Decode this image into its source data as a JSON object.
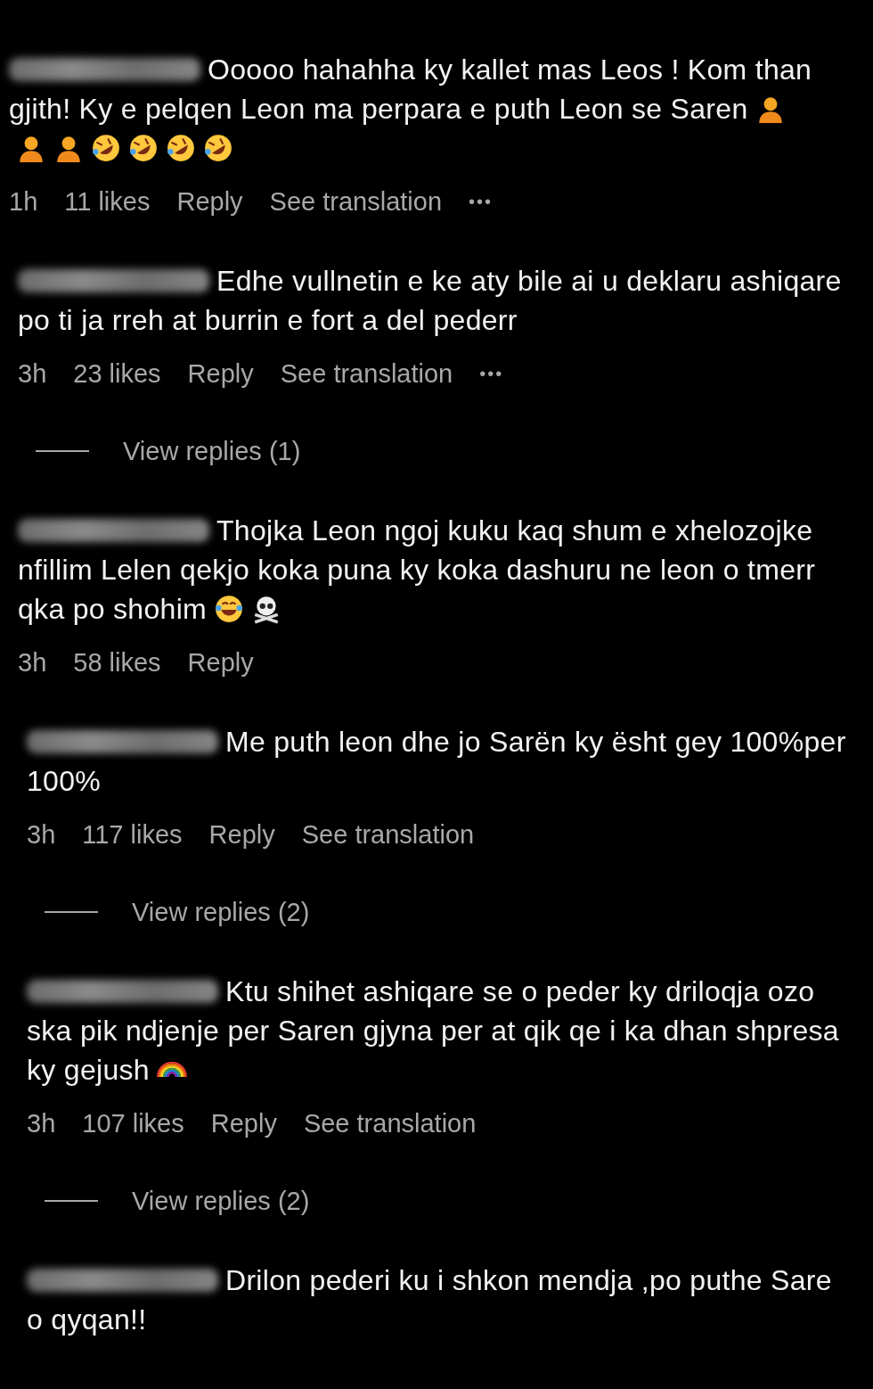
{
  "comments": [
    {
      "lines": [
        {
          "text": "Ooooo hahahha ky kallet mas Leos ! Kom than"
        },
        {
          "text": "gjith! Ky e pelqen Leon ma perpara e puth Leon se Saren",
          "emojis": [
            {
              "kind": "person"
            }
          ]
        },
        {
          "emojis": [
            {
              "kind": "person"
            },
            {
              "kind": "person"
            },
            {
              "kind": "rofl"
            },
            {
              "kind": "rofl"
            },
            {
              "kind": "rofl"
            },
            {
              "kind": "rofl"
            }
          ]
        }
      ],
      "time": "1h",
      "likes": "11 likes",
      "actions": [
        "Reply",
        "See translation"
      ],
      "more": "•••"
    },
    {
      "lines": [
        {
          "text": "Edhe vullnetin e ke aty bile ai u deklaru ashiqare"
        },
        {
          "text": "po ti ja rreh at burrin e fort a del pederr"
        }
      ],
      "time": "3h",
      "likes": "23 likes",
      "actions": [
        "Reply",
        "See translation"
      ],
      "more": "•••",
      "view_replies": "View replies (1)"
    },
    {
      "lines": [
        {
          "text": "Thojka Leon ngoj kuku kaq shum e xhelozojke"
        },
        {
          "text": "nfillim Lelen qekjo koka puna ky koka dashuru ne leon o tmerr"
        },
        {
          "text": "qka po shohim",
          "emojis": [
            {
              "kind": "joy"
            },
            {
              "kind": "skull"
            }
          ]
        }
      ],
      "time": "3h",
      "likes": "58 likes",
      "actions": [
        "Reply"
      ]
    },
    {
      "lines": [
        {
          "text": "Me puth leon dhe jo Sarën ky ësht gey 100%per"
        },
        {
          "text": "100%"
        }
      ],
      "time": "3h",
      "likes": "117 likes",
      "actions": [
        "Reply",
        "See translation"
      ],
      "view_replies": "View replies (2)"
    },
    {
      "lines": [
        {
          "text": "Ktu shihet ashiqare se o peder ky driloqja ozo"
        },
        {
          "text": "ska pik ndjenje per Saren gjyna per at qik qe i ka dhan shpresa"
        },
        {
          "text": "ky gejush",
          "emojis": [
            {
              "kind": "rainbow"
            }
          ]
        }
      ],
      "time": "3h",
      "likes": "107 likes",
      "actions": [
        "Reply",
        "See translation"
      ],
      "view_replies": "View replies (2)"
    },
    {
      "lines": [
        {
          "text": "Drilon pederi ku i shkon mendja ,po puthe Sare"
        },
        {
          "text": "o qyqan!!"
        }
      ]
    }
  ]
}
